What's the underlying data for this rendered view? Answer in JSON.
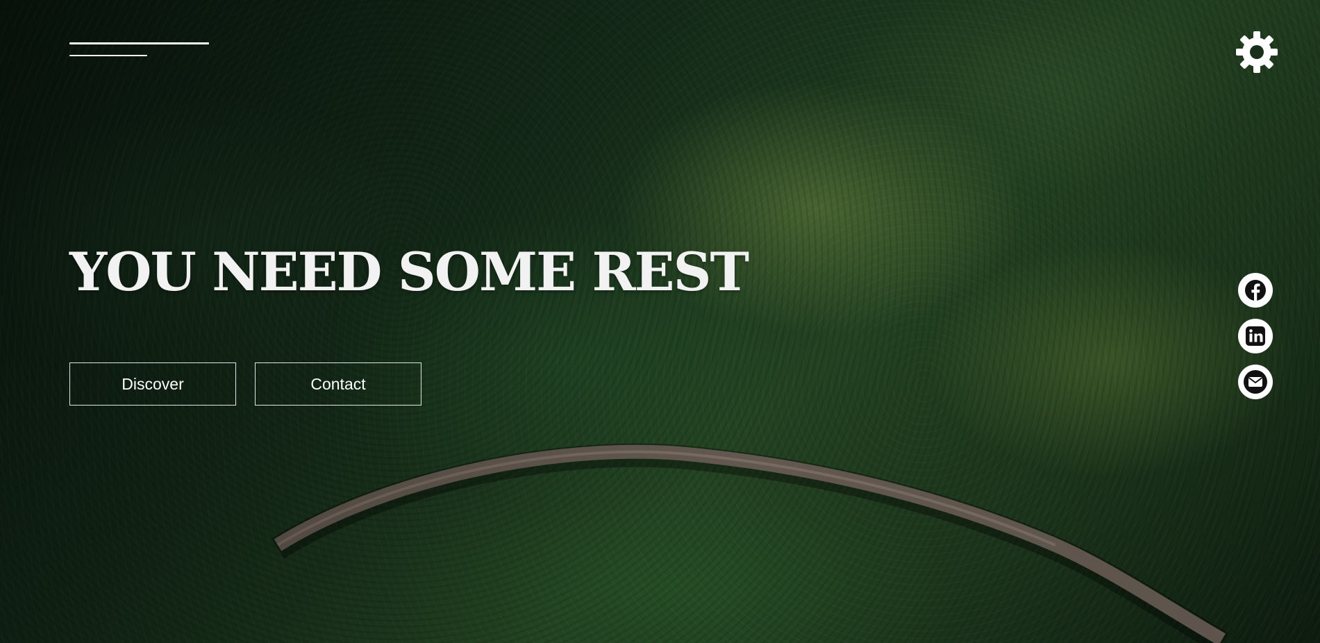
{
  "header": {
    "menu_icon": "menu-lines-icon",
    "settings_icon": "gear-icon"
  },
  "hero": {
    "headline": "YOU NEED SOME REST",
    "buttons": {
      "discover": "Discover",
      "contact": "Contact"
    },
    "background": "aerial-forest-with-road-image"
  },
  "social": [
    {
      "name": "facebook",
      "icon": "facebook-icon"
    },
    {
      "name": "linkedin",
      "icon": "linkedin-icon"
    },
    {
      "name": "email",
      "icon": "email-icon"
    }
  ],
  "colors": {
    "text": "#ffffff",
    "button_border": "#e6e6e6",
    "social_bg": "#ffffff",
    "social_fg": "#111111"
  }
}
